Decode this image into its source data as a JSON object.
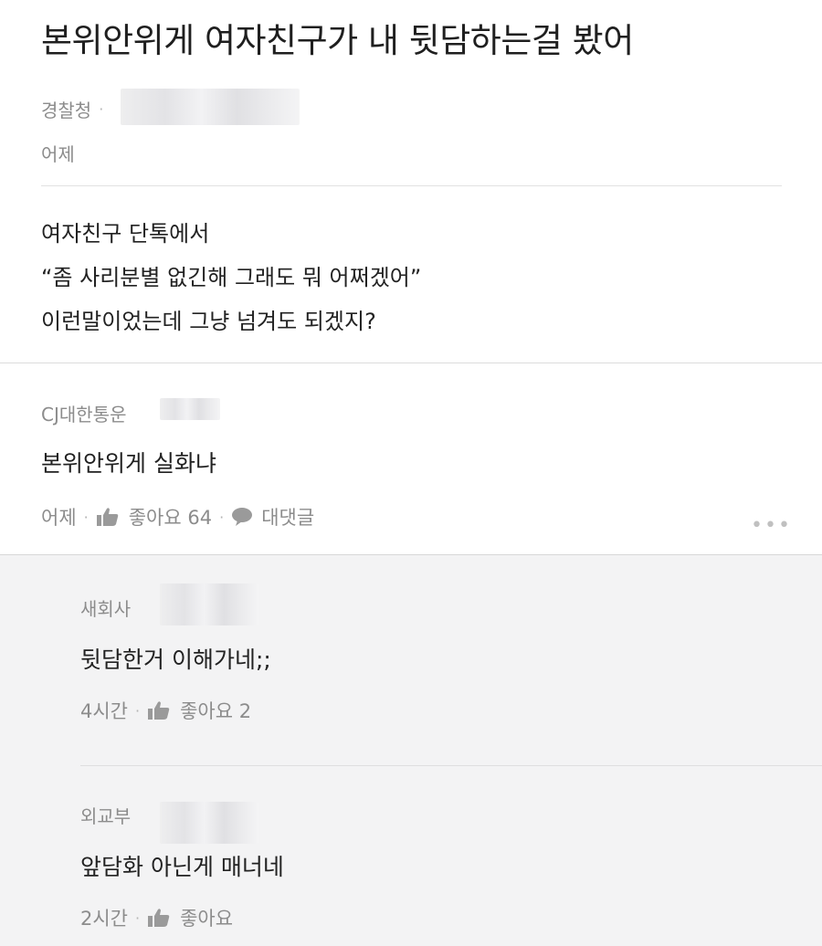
{
  "post": {
    "title": "본위안위게 여자친구가 내 뒷담하는걸 봤어",
    "author": "경찰청",
    "date": "어제",
    "body": [
      "여자친구 단톡에서",
      "“좀 사리분별 없긴해 그래도 뭐 어쩌겠어”",
      "이런말이었는데 그냥 넘겨도 되겠지?"
    ]
  },
  "comment": {
    "author": "CJ대한통운",
    "text": "본위안위게 실화냐",
    "time": "어제",
    "like_label": "좋아요 64",
    "reply_label": "대댓글",
    "more": "•••"
  },
  "replies": [
    {
      "author": "새회사",
      "text": "뒷담한거 이해가네;;",
      "time": "4시간",
      "like_label": "좋아요 2"
    },
    {
      "author": "외교부",
      "text": "앞담화 아닌게 매너네",
      "time": "2시간",
      "like_label": "좋아요"
    }
  ],
  "separator": "·",
  "icons": {
    "like": "thumbs-up-icon",
    "reply": "speech-bubble-icon",
    "more": "more-dots-icon"
  }
}
